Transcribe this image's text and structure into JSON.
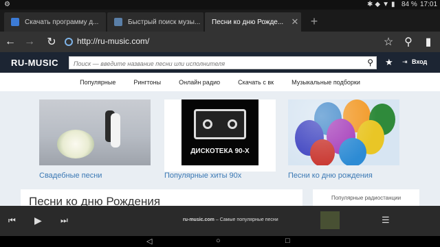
{
  "status": {
    "battery": "84 %",
    "time": "17:01"
  },
  "tabs": [
    {
      "title": "Скачать программу д...",
      "favColor": "#3c7bd6"
    },
    {
      "title": "Быстрый поиск музы...",
      "favColor": "#5a7fa8"
    },
    {
      "title": "Песни ко дню Рожде..."
    }
  ],
  "browser": {
    "url": "http://ru-music.com/"
  },
  "site": {
    "logo": "RU-MUSIC",
    "search_placeholder": "Поиск — введите название песни или исполнителя",
    "login": "Вход",
    "nav": [
      "Популярные",
      "Рингтоны",
      "Онлайн радио",
      "Скачать с вк",
      "Музыкальные подборки"
    ],
    "cards": [
      {
        "label": "Свадебные песни"
      },
      {
        "label": "Популярные хиты 90х",
        "image_text": "ДИСКОТЕКА 90-Х"
      },
      {
        "label": "Песни ко дню рождения"
      }
    ],
    "main_title": "Песни ко дню Рождения",
    "side_title": "Популярные радиостанции"
  },
  "player": {
    "site": "ru-music.com",
    "text": " – Самые популярные песни"
  }
}
